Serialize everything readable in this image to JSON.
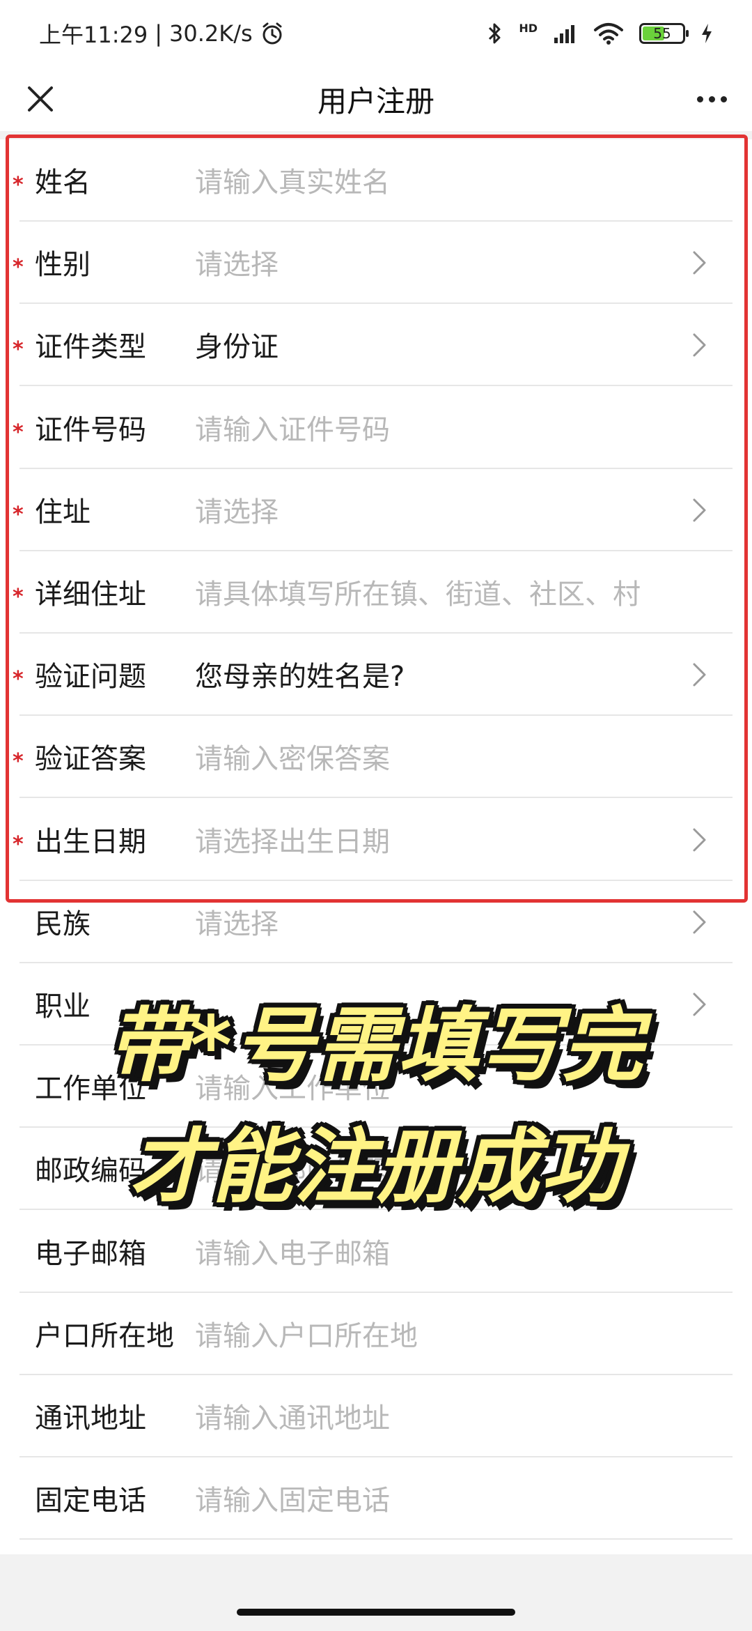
{
  "status": {
    "time": "上午11:29",
    "speed": "30.2K/s",
    "network": "HD",
    "battery": "55",
    "battery_level": 0.55
  },
  "nav": {
    "title": "用户注册"
  },
  "fields": [
    {
      "label": "姓名",
      "value": "请输入真实姓名",
      "required": true,
      "placeholder": true,
      "chevron": false
    },
    {
      "label": "性别",
      "value": "请选择",
      "required": true,
      "placeholder": true,
      "chevron": true
    },
    {
      "label": "证件类型",
      "value": "身份证",
      "required": true,
      "placeholder": false,
      "chevron": true
    },
    {
      "label": "证件号码",
      "value": "请输入证件号码",
      "required": true,
      "placeholder": true,
      "chevron": false
    },
    {
      "label": "住址",
      "value": "请选择",
      "required": true,
      "placeholder": true,
      "chevron": true
    },
    {
      "label": "详细住址",
      "value": "请具体填写所在镇、街道、社区、村",
      "required": true,
      "placeholder": true,
      "chevron": false
    },
    {
      "label": "验证问题",
      "value": "您母亲的姓名是?",
      "required": true,
      "placeholder": false,
      "chevron": true
    },
    {
      "label": "验证答案",
      "value": "请输入密保答案",
      "required": true,
      "placeholder": true,
      "chevron": false
    },
    {
      "label": "出生日期",
      "value": "请选择出生日期",
      "required": true,
      "placeholder": true,
      "chevron": true
    },
    {
      "label": "民族",
      "value": "请选择",
      "required": false,
      "placeholder": true,
      "chevron": true
    },
    {
      "label": "职业",
      "value": "",
      "required": false,
      "placeholder": true,
      "chevron": true
    },
    {
      "label": "工作单位",
      "value": "请输入工作单位",
      "required": false,
      "placeholder": true,
      "chevron": false
    },
    {
      "label": "邮政编码",
      "value": "请输入邮政编码",
      "required": false,
      "placeholder": true,
      "chevron": false
    },
    {
      "label": "电子邮箱",
      "value": "请输入电子邮箱",
      "required": false,
      "placeholder": true,
      "chevron": false
    },
    {
      "label": "户口所在地",
      "value": "请输入户口所在地",
      "required": false,
      "placeholder": true,
      "chevron": false
    },
    {
      "label": "通讯地址",
      "value": "请输入通讯地址",
      "required": false,
      "placeholder": true,
      "chevron": false
    },
    {
      "label": "固定电话",
      "value": "请输入固定电话",
      "required": false,
      "placeholder": true,
      "chevron": false
    }
  ],
  "required_mark": "*",
  "overlay": {
    "line1": "带*号需填写完",
    "line2": "才能注册成功"
  },
  "colors": {
    "highlight": "#e23333",
    "required": "#d7262b",
    "overlay_text": "#fff385"
  }
}
